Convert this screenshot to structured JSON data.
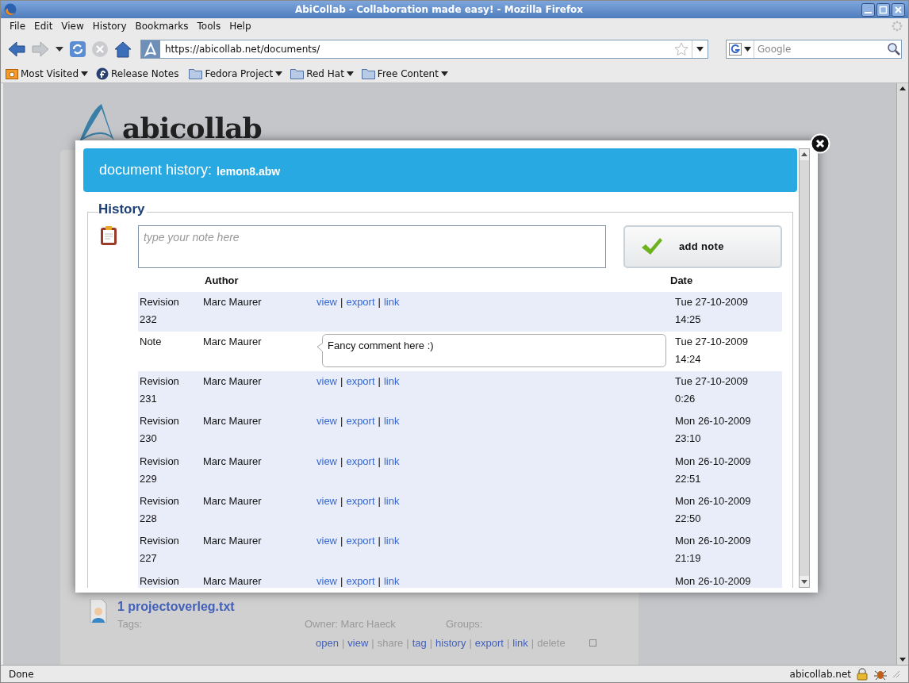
{
  "window": {
    "title": "AbiCollab - Collaboration made easy! - Mozilla Firefox"
  },
  "menu": [
    "File",
    "Edit",
    "View",
    "History",
    "Bookmarks",
    "Tools",
    "Help"
  ],
  "address_bar": {
    "value": "https://abicollab.net/documents/"
  },
  "search": {
    "placeholder": "Google"
  },
  "bookmarks": [
    {
      "kind": "smart",
      "label": "Most Visited",
      "menu": true
    },
    {
      "kind": "page",
      "label": "Release Notes",
      "menu": false
    },
    {
      "kind": "folder",
      "label": "Fedora Project",
      "menu": true
    },
    {
      "kind": "folder",
      "label": "Red Hat",
      "menu": true
    },
    {
      "kind": "folder",
      "label": "Free Content",
      "menu": true
    }
  ],
  "page": {
    "logo": "abicollab",
    "document": {
      "name": "1 projectoverleg.txt",
      "tags": "Tags:",
      "owner": "Owner: Marc Haeck",
      "groups": "Groups:",
      "actions": [
        {
          "kind": "link",
          "label": "open",
          "disabled": false
        },
        {
          "kind": "separator",
          "label": "|"
        },
        {
          "kind": "link",
          "label": "view",
          "disabled": false
        },
        {
          "kind": "separator",
          "label": "|"
        },
        {
          "kind": "link",
          "label": "share",
          "disabled": true
        },
        {
          "kind": "separator",
          "label": "|"
        },
        {
          "kind": "link",
          "label": "tag",
          "disabled": false
        },
        {
          "kind": "separator",
          "label": "|"
        },
        {
          "kind": "link",
          "label": "history",
          "disabled": false
        },
        {
          "kind": "separator",
          "label": "|"
        },
        {
          "kind": "link",
          "label": "export",
          "disabled": false
        },
        {
          "kind": "separator",
          "label": "|"
        },
        {
          "kind": "link",
          "label": "link",
          "disabled": false
        },
        {
          "kind": "separator",
          "label": "|"
        },
        {
          "kind": "link",
          "label": "delete",
          "disabled": true
        }
      ],
      "checked": false
    }
  },
  "dialog": {
    "title": "document history:",
    "filename": "lemon8.abw",
    "section": "History",
    "note_field": {
      "placeholder": "type your note here"
    },
    "add_button": "add note",
    "columns": {
      "author": "Author",
      "date": "Date"
    },
    "rows": [
      {
        "kind": "revision",
        "label": "Revision",
        "number": "232",
        "author": "Marc Maurer",
        "actions": [
          {
            "kind": "link",
            "label": "view"
          },
          {
            "kind": "separator",
            "label": "|"
          },
          {
            "kind": "link",
            "label": "export"
          },
          {
            "kind": "separator",
            "label": "|"
          },
          {
            "kind": "link",
            "label": "link"
          }
        ],
        "date": "Tue 27-10-2009",
        "time": "14:25"
      },
      {
        "kind": "note",
        "label": "Note",
        "author": "Marc Maurer",
        "note": "Fancy comment here :)",
        "date": "Tue 27-10-2009",
        "time": "14:24"
      },
      {
        "kind": "revision",
        "label": "Revision",
        "number": "231",
        "author": "Marc Maurer",
        "actions": [
          {
            "kind": "link",
            "label": "view"
          },
          {
            "kind": "separator",
            "label": "|"
          },
          {
            "kind": "link",
            "label": "export"
          },
          {
            "kind": "separator",
            "label": "|"
          },
          {
            "kind": "link",
            "label": "link"
          }
        ],
        "date": "Tue 27-10-2009",
        "time": "0:26"
      },
      {
        "kind": "revision",
        "label": "Revision",
        "number": "230",
        "author": "Marc Maurer",
        "actions": [
          {
            "kind": "link",
            "label": "view"
          },
          {
            "kind": "separator",
            "label": "|"
          },
          {
            "kind": "link",
            "label": "export"
          },
          {
            "kind": "separator",
            "label": "|"
          },
          {
            "kind": "link",
            "label": "link"
          }
        ],
        "date": "Mon 26-10-2009",
        "time": "23:10"
      },
      {
        "kind": "revision",
        "label": "Revision",
        "number": "229",
        "author": "Marc Maurer",
        "actions": [
          {
            "kind": "link",
            "label": "view"
          },
          {
            "kind": "separator",
            "label": "|"
          },
          {
            "kind": "link",
            "label": "export"
          },
          {
            "kind": "separator",
            "label": "|"
          },
          {
            "kind": "link",
            "label": "link"
          }
        ],
        "date": "Mon 26-10-2009",
        "time": "22:51"
      },
      {
        "kind": "revision",
        "label": "Revision",
        "number": "228",
        "author": "Marc Maurer",
        "actions": [
          {
            "kind": "link",
            "label": "view"
          },
          {
            "kind": "separator",
            "label": "|"
          },
          {
            "kind": "link",
            "label": "export"
          },
          {
            "kind": "separator",
            "label": "|"
          },
          {
            "kind": "link",
            "label": "link"
          }
        ],
        "date": "Mon 26-10-2009",
        "time": "22:50"
      },
      {
        "kind": "revision",
        "label": "Revision",
        "number": "227",
        "author": "Marc Maurer",
        "actions": [
          {
            "kind": "link",
            "label": "view"
          },
          {
            "kind": "separator",
            "label": "|"
          },
          {
            "kind": "link",
            "label": "export"
          },
          {
            "kind": "separator",
            "label": "|"
          },
          {
            "kind": "link",
            "label": "link"
          }
        ],
        "date": "Mon 26-10-2009",
        "time": "21:19"
      },
      {
        "kind": "revision",
        "label": "Revision",
        "author": "Marc Maurer",
        "actions": [
          {
            "kind": "link",
            "label": "view"
          },
          {
            "kind": "separator",
            "label": "|"
          },
          {
            "kind": "link",
            "label": "export"
          },
          {
            "kind": "separator",
            "label": "|"
          },
          {
            "kind": "link",
            "label": "link"
          }
        ],
        "date": "Mon 26-10-2009"
      }
    ]
  },
  "status_bar": {
    "text": "Done",
    "host": "abicollab.net"
  }
}
